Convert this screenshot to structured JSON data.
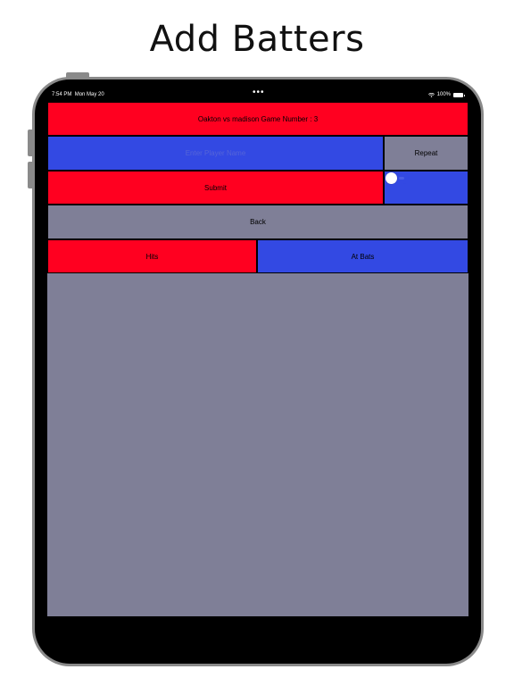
{
  "page": {
    "heading": "Add Batters"
  },
  "status_bar": {
    "time": "7:54 PM",
    "date": "Mon May 20",
    "battery_percent": "100%"
  },
  "game": {
    "title": "Oakton vs madison Game Number : 3"
  },
  "batter_form": {
    "name_placeholder": "Enter Player Name",
    "repeat_label": "Repeat",
    "repeat_enabled": false,
    "submit_label": "Submit"
  },
  "navigation": {
    "back_label": "Back"
  },
  "stats_header": {
    "hits_label": "Hits",
    "at_bats_label": "At Bats"
  },
  "colors": {
    "red": "#ff0020",
    "blue": "#3349e3",
    "gray": "#7f7f97",
    "background": "#000000"
  }
}
